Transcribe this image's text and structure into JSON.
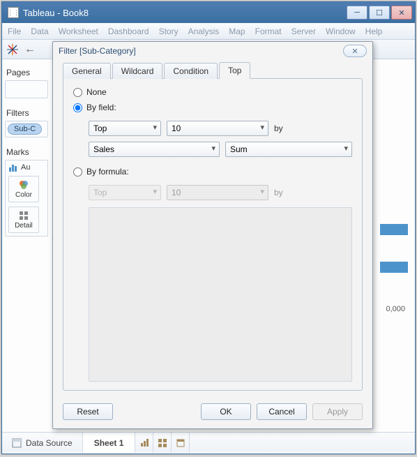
{
  "window": {
    "title": "Tableau - Book8",
    "min_tip": "Minimize",
    "max_tip": "Maximize",
    "close_tip": "Close"
  },
  "menu": {
    "items": [
      "File",
      "Data",
      "Worksheet",
      "Dashboard",
      "Story",
      "Analysis",
      "Map",
      "Format",
      "Server",
      "Window",
      "Help"
    ]
  },
  "left": {
    "pages_label": "Pages",
    "filters_label": "Filters",
    "filter_pill": "Sub-C",
    "marks_label": "Marks",
    "marks_type_prefix": "Au",
    "color_label": "Color",
    "detail_label": "Detail"
  },
  "canvas": {
    "axis_tick": "0,000"
  },
  "sheetbar": {
    "datasource": "Data Source",
    "sheet": "Sheet 1"
  },
  "dialog": {
    "title": "Filter [Sub-Category]",
    "tabs": {
      "general": "General",
      "wildcard": "Wildcard",
      "condition": "Condition",
      "top": "Top"
    },
    "active_tab": "top",
    "options": {
      "none": "None",
      "by_field": "By field:",
      "by_formula": "By formula:"
    },
    "selected_option": "by_field",
    "by_field": {
      "direction": "Top",
      "count": "10",
      "by_label": "by",
      "measure": "Sales",
      "agg": "Sum"
    },
    "by_formula": {
      "direction": "Top",
      "count": "10",
      "by_label": "by"
    },
    "buttons": {
      "reset": "Reset",
      "ok": "OK",
      "cancel": "Cancel",
      "apply": "Apply"
    }
  }
}
